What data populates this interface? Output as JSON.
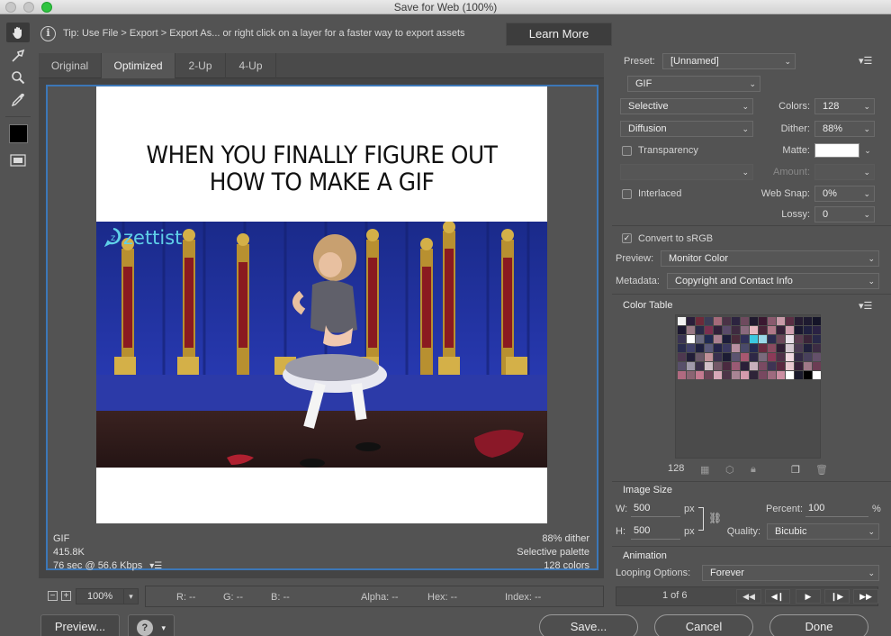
{
  "window": {
    "title": "Save for Web (100%)"
  },
  "tip": {
    "text": "Tip: Use File > Export > Export As...  or right click on a layer for a faster way to export assets",
    "learn_more": "Learn More"
  },
  "tabs": [
    "Original",
    "Optimized",
    "2-Up",
    "4-Up"
  ],
  "preview": {
    "caption_line1": "WHEN YOU FINALLY FIGURE OUT",
    "caption_line2": "HOW TO MAKE A GIF",
    "watermark": "zettist",
    "info_left": [
      "GIF",
      "415.8K",
      "76 sec @ 56.6 Kbps"
    ],
    "info_right": [
      "88% dither",
      "Selective palette",
      "128 colors"
    ]
  },
  "status": {
    "zoom": "100%",
    "r": "R: --",
    "g": "G: --",
    "b": "B: --",
    "alpha": "Alpha: --",
    "hex": "Hex: --",
    "index": "Index: --"
  },
  "buttons": {
    "preview": "Preview...",
    "save": "Save...",
    "cancel": "Cancel",
    "done": "Done"
  },
  "settings": {
    "preset_label": "Preset:",
    "preset_value": "[Unnamed]",
    "format": "GIF",
    "reduction": "Selective",
    "colors_label": "Colors:",
    "colors_value": "128",
    "dither_algo": "Diffusion",
    "dither_label": "Dither:",
    "dither_value": "88%",
    "transparency_label": "Transparency",
    "transparency_checked": false,
    "matte_label": "Matte:",
    "matte_color": "#ffffff",
    "amount_label": "Amount:",
    "interlaced_label": "Interlaced",
    "interlaced_checked": false,
    "websnap_label": "Web Snap:",
    "websnap_value": "0%",
    "lossy_label": "Lossy:",
    "lossy_value": "0",
    "convert_srgb_label": "Convert to sRGB",
    "convert_srgb_checked": true,
    "preview_label": "Preview:",
    "preview_value": "Monitor Color",
    "metadata_label": "Metadata:",
    "metadata_value": "Copyright and Contact Info"
  },
  "color_table": {
    "title": "Color Table",
    "count": "128",
    "colors": [
      "#f2f2f2",
      "#2a1e3a",
      "#6d2a3a",
      "#3c3d56",
      "#a46a7a",
      "#4a3246",
      "#2c2440",
      "#6e4a5e",
      "#201a2e",
      "#3a1830",
      "#8a5a6e",
      "#c89aa8",
      "#5a2e44",
      "#261c32",
      "#1e1a30",
      "#141428",
      "#1c1830",
      "#9a7a86",
      "#2a2a48",
      "#7a3050",
      "#30203a",
      "#5a4a6a",
      "#3e2a40",
      "#8a6a7e",
      "#e6b8c0",
      "#482438",
      "#b07888",
      "#362038",
      "#d0a0b0",
      "#1a1830",
      "#202040",
      "#2a2244",
      "#3a3452",
      "#ffffff",
      "#6a6a80",
      "#202a52",
      "#aa8090",
      "#1c1c3a",
      "#4a2a3a",
      "#30305a",
      "#3ac8e0",
      "#9ad8e8",
      "#2c2c50",
      "#6a4658",
      "#e8e0e8",
      "#5a3c50",
      "#3a2438",
      "#282848",
      "#2a2c4e",
      "#40406a",
      "#1e2040",
      "#5a5a7a",
      "#24244a",
      "#3a3860",
      "#b890a0",
      "#4a4a6a",
      "#262a52",
      "#6a2a40",
      "#8a4a60",
      "#301e34",
      "#d4c8d0",
      "#4a3a52",
      "#20203c",
      "#3c2c44",
      "#4e3850",
      "#221e38",
      "#6a5868",
      "#c09098",
      "#38304e",
      "#1c1c34",
      "#5c5470",
      "#a85870",
      "#2e2846",
      "#7a6a7c",
      "#8c3a58",
      "#503048",
      "#f0d8e0",
      "#342a46",
      "#48405c",
      "#64506a",
      "#58506a",
      "#a09aaa",
      "#3a304a",
      "#d0c0c8",
      "#745868",
      "#4a2a40",
      "#9a5a74",
      "#2a2038",
      "#c8b0bc",
      "#7a4a62",
      "#3e3454",
      "#5a2840",
      "#e8c8d0",
      "#38203a",
      "#a07888",
      "#6c3c54",
      "#b06a80",
      "#8a6472",
      "#c47a90",
      "#6a4456",
      "#d8a8b8",
      "#4c3448",
      "#a88494",
      "#d49cac",
      "#2e2438",
      "#784860",
      "#9e6a7e",
      "#cc8ea2",
      "#ffffff",
      "#1a1a2c",
      "#000000",
      "#ffffff"
    ]
  },
  "image_size": {
    "title": "Image Size",
    "w_label": "W:",
    "w_value": "500",
    "h_label": "H:",
    "h_value": "500",
    "unit": "px",
    "percent_label": "Percent:",
    "percent_value": "100",
    "percent_unit": "%",
    "quality_label": "Quality:",
    "quality_value": "Bicubic"
  },
  "animation": {
    "title": "Animation",
    "looping_label": "Looping Options:",
    "looping_value": "Forever",
    "frame": "1 of 6"
  }
}
